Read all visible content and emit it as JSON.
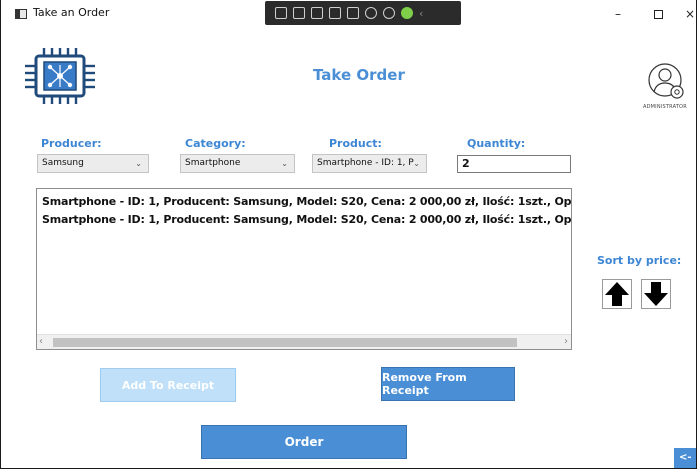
{
  "window": {
    "title": "Take an Order",
    "controls": {
      "minimize": "–",
      "maximize": "",
      "close": "×"
    }
  },
  "header": {
    "title": "Take Order",
    "logo_icon": "chip-icon",
    "avatar_icon": "admin-user-gear-icon",
    "avatar_label": "ADMINISTRATOR"
  },
  "form": {
    "producer": {
      "label": "Producer:",
      "value": "Samsung"
    },
    "category": {
      "label": "Category:",
      "value": "Smartphone"
    },
    "product": {
      "label": "Product:",
      "value": "Smartphone - ID: 1, P"
    },
    "quantity": {
      "label": "Quantity:",
      "value": "2"
    }
  },
  "list": {
    "items": [
      "Smartphone - ID: 1, Producent: Samsung, Model: S20, Cena: 2 000,00 zł, Ilość: 1szt., Op",
      "Smartphone - ID: 1, Producent: Samsung, Model: S20, Cena: 2 000,00 zł, Ilość: 1szt., Op"
    ]
  },
  "sort": {
    "label": "Sort by price:",
    "up_icon": "arrow-up-icon",
    "down_icon": "arrow-down-icon"
  },
  "buttons": {
    "add": "Add To Receipt",
    "remove": "Remove From Receipt",
    "order": "Order",
    "back": "<-"
  },
  "colors": {
    "accent": "#4a8fd6",
    "label": "#3d86d3",
    "disabled_button": "#bfe0f8",
    "logo": "#1f4a7a"
  }
}
